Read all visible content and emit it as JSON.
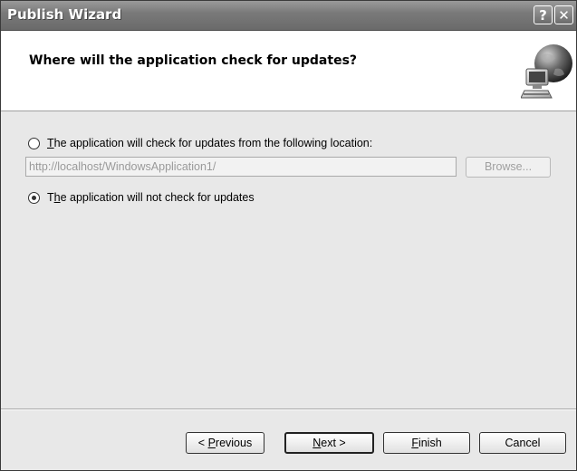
{
  "window": {
    "title": "Publish Wizard",
    "help_glyph": "?",
    "close_glyph": "✕"
  },
  "header": {
    "heading": "Where will the application check for updates?",
    "icon": "globe-computer-icon"
  },
  "options": {
    "check_updates": {
      "prefix": "",
      "mnemonic": "T",
      "rest": "he application will check for updates from the following location:",
      "selected": false
    },
    "url_value": "http://localhost/WindowsApplication1/",
    "browse_label": "Browse...",
    "no_updates": {
      "prefix": "T",
      "mnemonic": "h",
      "rest": "e application will not check for updates",
      "selected": true
    }
  },
  "buttons": {
    "previous": {
      "prefix": "< ",
      "mnemonic": "P",
      "rest": "revious"
    },
    "next": {
      "prefix": "",
      "mnemonic": "N",
      "rest": "ext >"
    },
    "finish": {
      "prefix": "",
      "mnemonic": "F",
      "rest": "inish"
    },
    "cancel": "Cancel"
  }
}
